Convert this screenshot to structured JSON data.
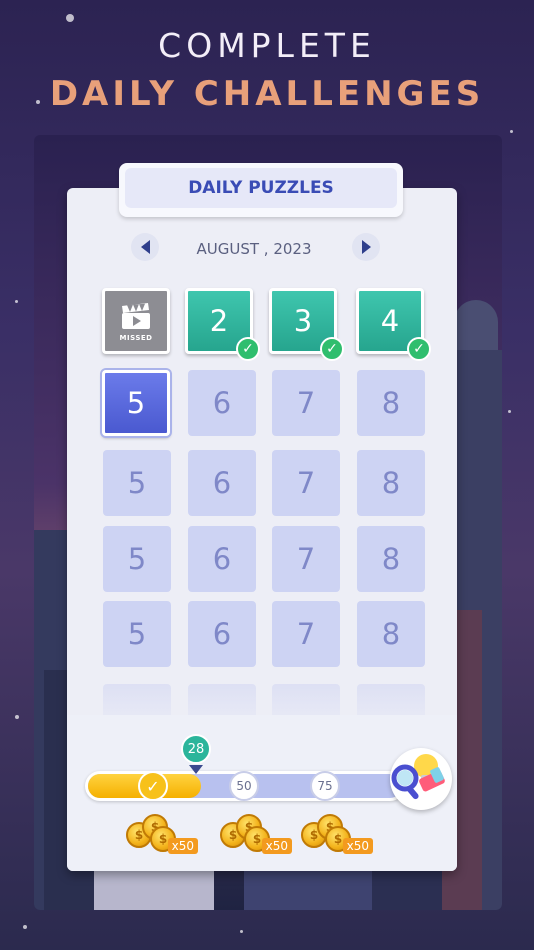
{
  "headline": {
    "line1": "COMPLETE",
    "line2": "DAILY CHALLENGES"
  },
  "panel": {
    "title": "DAILY PUZZLES",
    "month": "AUGUST , 2023"
  },
  "nav": {
    "prev_icon": "chevron-left-icon",
    "next_icon": "chevron-right-icon"
  },
  "days": {
    "missed": {
      "label": "MISSED",
      "icon": "video-clapperboard-icon"
    },
    "done": [
      "2",
      "3",
      "4"
    ],
    "current": "5",
    "rows": [
      [
        "6",
        "7",
        "8"
      ],
      [
        "5",
        "6",
        "7",
        "8"
      ],
      [
        "5",
        "6",
        "7",
        "8"
      ],
      [
        "5",
        "6",
        "7",
        "8"
      ]
    ]
  },
  "progress": {
    "current": "28",
    "fraction": 0.28,
    "milestones": [
      "50",
      "75"
    ],
    "reward_qty": [
      "x50",
      "x50",
      "x50"
    ]
  },
  "colors": {
    "done_green": "#2bb59b",
    "current_blue": "#5565dc",
    "bar_yellow": "#f7c11a",
    "headline_accent": "#e8a07a"
  }
}
